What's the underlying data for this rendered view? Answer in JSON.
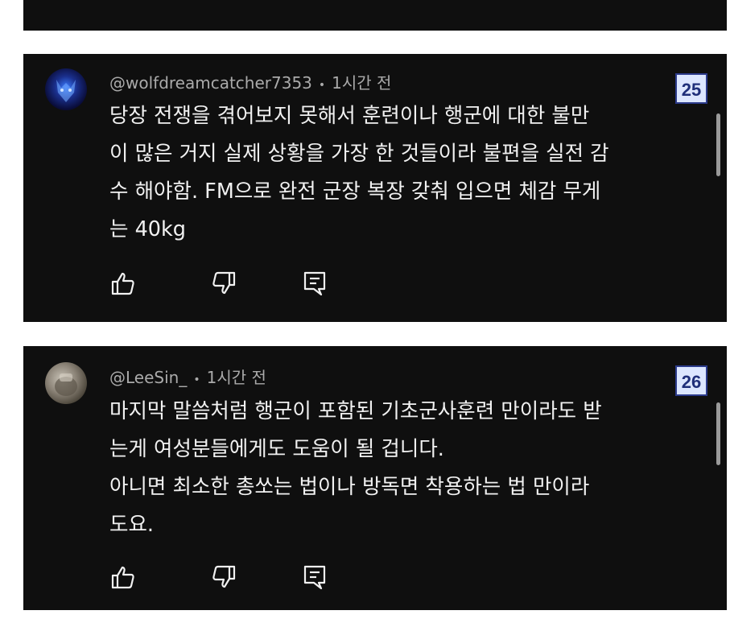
{
  "comments": [
    {
      "author": "@wolfdreamcatcher7353",
      "time": "1시간 전",
      "badge": "25",
      "lines": [
        "당장 전쟁을 겪어보지 못해서 훈련이나 행군에 대한 불만",
        "이 많은 거지 실제 상황을 가장 한 것들이라 불편을 실전 감",
        "수 해야함. FM으로 완전 군장 복장 갖춰 입으면 체감 무게",
        "는 40kg"
      ],
      "avatar_icon": "wolf-avatar-icon"
    },
    {
      "author": "@LeeSin_",
      "time": "1시간 전",
      "badge": "26",
      "lines": [
        "마지막 말씀처럼 행군이 포함된 기초군사훈련 만이라도 받",
        "는게 여성분들에게도 도움이 될 겁니다.",
        "아니면 최소한 총쏘는 법이나 방독면 착용하는 법 만이라",
        "도요."
      ],
      "avatar_icon": "user-avatar-icon"
    }
  ],
  "separator": "•",
  "actions": {
    "like_icon": "thumbs-up-icon",
    "dislike_icon": "thumbs-down-icon",
    "reply_icon": "reply-icon"
  },
  "colors": {
    "card_bg": "#0f0f0f",
    "text": "#f1f1f1",
    "meta": "#aaaaaa",
    "badge_bg": "#dce6ff",
    "badge_border": "#2b3a8a"
  }
}
